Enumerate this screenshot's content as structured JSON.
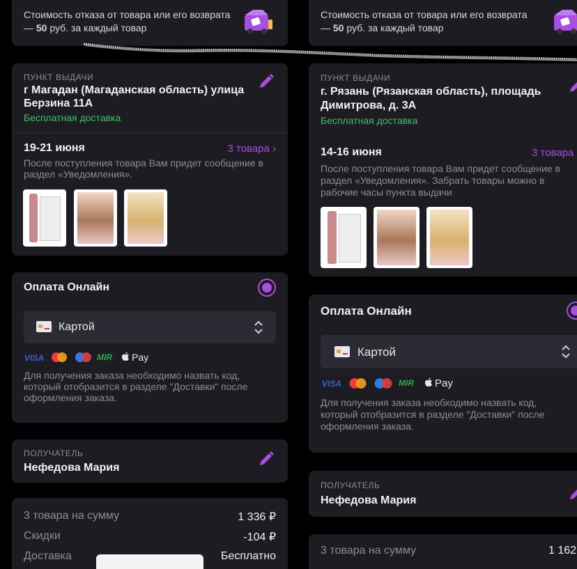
{
  "left": {
    "return_note": {
      "line1": "Стоимость отказа от товара или его возврата",
      "line2_prefix": "— ",
      "amount": "50",
      "line2_suffix": " руб. за каждый товар"
    },
    "pickup": {
      "label": "ПУНКТ ВЫДАЧИ",
      "address": "г Магадан (Магаданская область) улица Берзина 11А",
      "free_delivery": "Бесплатная доставка",
      "dates": "19-21 июня",
      "items_link": "3 товара ›",
      "notice": "После поступления товара Вам придет сообщение в раздел «Уведомления»."
    },
    "payment": {
      "title": "Оплата Онлайн",
      "method": "Картой",
      "logos": [
        "VISA",
        "MIR",
        "Pay"
      ],
      "info": "Для получения заказа необходимо назвать код, который отобразится в разделе \"Доставки\" после оформления заказа."
    },
    "recipient": {
      "label": "ПОЛУЧАТЕЛЬ",
      "name": "Нефедова Мария"
    },
    "summary": {
      "items_label": "3 товара на сумму",
      "items_value": "1 336 ₽",
      "discount_label": "Скидки",
      "discount_value": "-104 ₽",
      "delivery_label": "Доставка",
      "delivery_value": "Бесплатно"
    }
  },
  "right": {
    "return_note": {
      "line1": "Стоимость отказа от товара или его возврата",
      "line2_prefix": "— ",
      "amount": "50",
      "line2_suffix": " руб. за каждый товар"
    },
    "pickup": {
      "label": "ПУНКТ ВЫДАЧИ",
      "address": "г. Рязань (Рязанская область), площадь Димитрова, д. 3А",
      "free_delivery": "Бесплатная доставка",
      "dates": "14-16 июня",
      "items_link": "3 товара",
      "notice": "После поступления товара Вам придет сообщение в раздел «Уведомления». Забрать товары можно в рабочие часы пункта выдачи"
    },
    "payment": {
      "title": "Оплата Онлайн",
      "method": "Картой",
      "logos": [
        "VISA",
        "MIR",
        "Pay"
      ],
      "info": "Для получения заказа необходимо назвать код, который отобразится в разделе \"Доставки\" после оформления заказа."
    },
    "recipient": {
      "label": "ПОЛУЧАТЕЛЬ",
      "name": "Нефедова Мария"
    },
    "summary": {
      "items_label": "3 товара на сумму",
      "items_value": "1 162"
    }
  },
  "colors": {
    "accent": "#a84ee0",
    "green": "#3ec06b",
    "card": "#1c1c22",
    "background": "#000000"
  },
  "icons": [
    "return-box-icon",
    "pencil-icon",
    "card-icon",
    "sort-arrows-icon",
    "mastercard-icon",
    "maestro-icon",
    "apple-icon",
    "radio-selected-icon"
  ]
}
